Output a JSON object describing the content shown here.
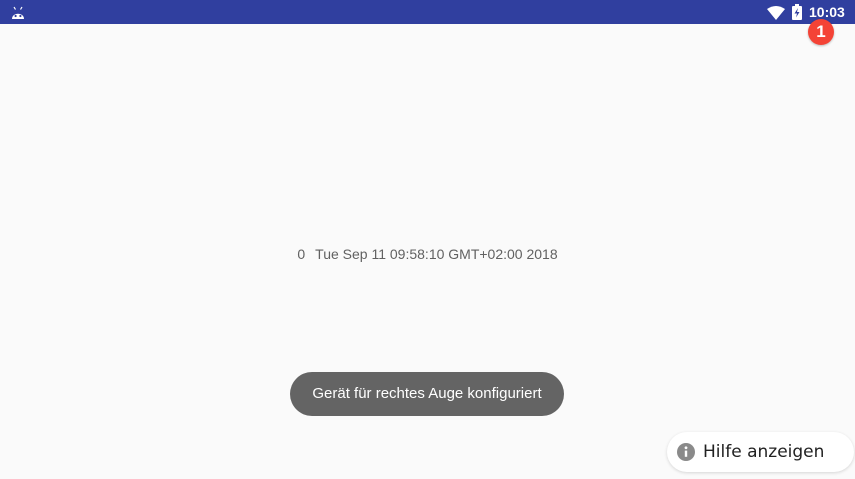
{
  "status_bar": {
    "time": "10:03",
    "background_color": "#303f9f",
    "icons": [
      "android-icon",
      "wifi-icon",
      "battery-charging-icon"
    ]
  },
  "notification_badge": {
    "count": "1",
    "color": "#f44336"
  },
  "main": {
    "counter": "0",
    "timestamp": "Tue Sep 11 09:58:10 GMT+02:00 2018"
  },
  "toast": {
    "message": "Gerät für rechtes Auge konfiguriert"
  },
  "help_button": {
    "label": "Hilfe anzeigen",
    "icon": "info-icon"
  }
}
